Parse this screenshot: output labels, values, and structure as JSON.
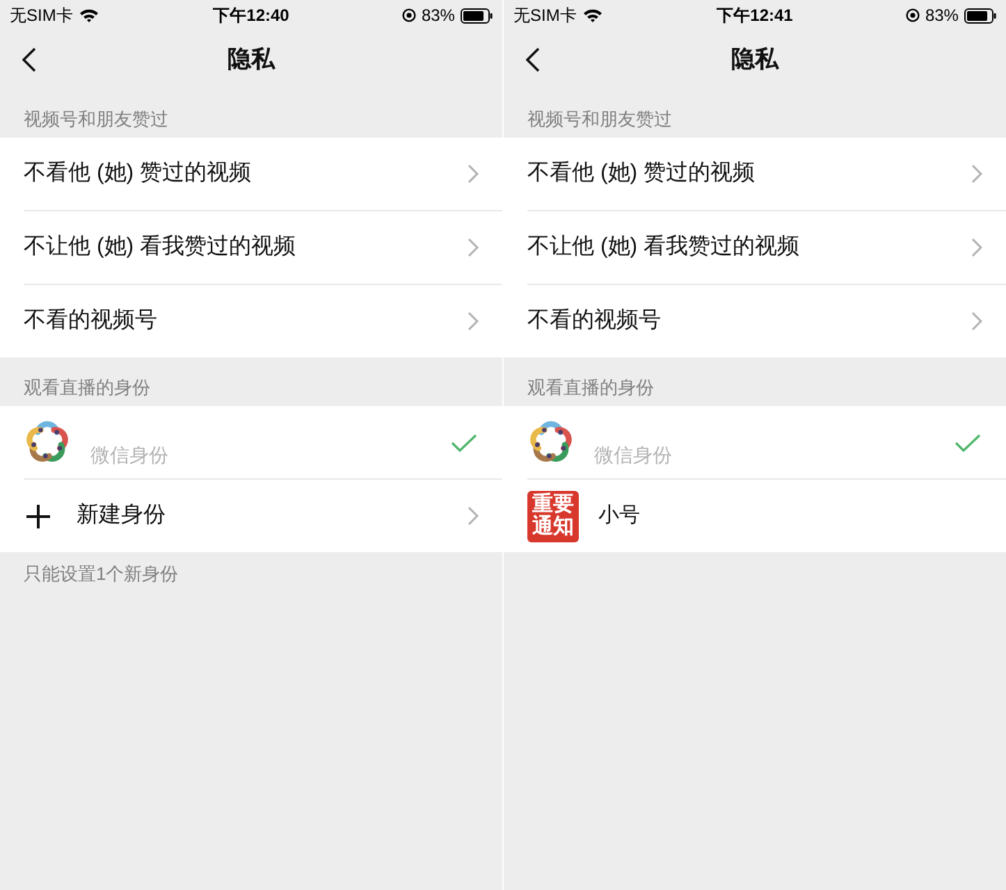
{
  "screens": [
    {
      "status_bar": {
        "carrier": "无SIM卡",
        "time": "下午12:40",
        "battery": "83%"
      },
      "nav": {
        "title": "隐私"
      },
      "sections": [
        {
          "header": "视频号和朋友赞过",
          "rows": [
            {
              "kind": "link",
              "label": "不看他 (她) 赞过的视频"
            },
            {
              "kind": "link",
              "label": "不让他 (她) 看我赞过的视频"
            },
            {
              "kind": "link",
              "label": "不看的视频号"
            }
          ]
        },
        {
          "header": "观看直播的身份",
          "rows": [
            {
              "kind": "identity",
              "avatar": {
                "kind": "logo"
              },
              "subtitle": "微信身份",
              "selected": true
            },
            {
              "kind": "add",
              "label": "新建身份"
            }
          ],
          "footer": "只能设置1个新身份"
        }
      ]
    },
    {
      "status_bar": {
        "carrier": "无SIM卡",
        "time": "下午12:41",
        "battery": "83%"
      },
      "nav": {
        "title": "隐私"
      },
      "sections": [
        {
          "header": "视频号和朋友赞过",
          "rows": [
            {
              "kind": "link",
              "label": "不看他 (她) 赞过的视频"
            },
            {
              "kind": "link",
              "label": "不让他 (她) 看我赞过的视频"
            },
            {
              "kind": "link",
              "label": "不看的视频号"
            }
          ]
        },
        {
          "header": "观看直播的身份",
          "rows": [
            {
              "kind": "identity",
              "avatar": {
                "kind": "logo"
              },
              "subtitle": "微信身份",
              "selected": true
            },
            {
              "kind": "identity",
              "avatar": {
                "kind": "text",
                "lines": [
                  "重要",
                  "通知"
                ]
              },
              "label": "小号",
              "selected": false
            }
          ]
        }
      ]
    }
  ]
}
